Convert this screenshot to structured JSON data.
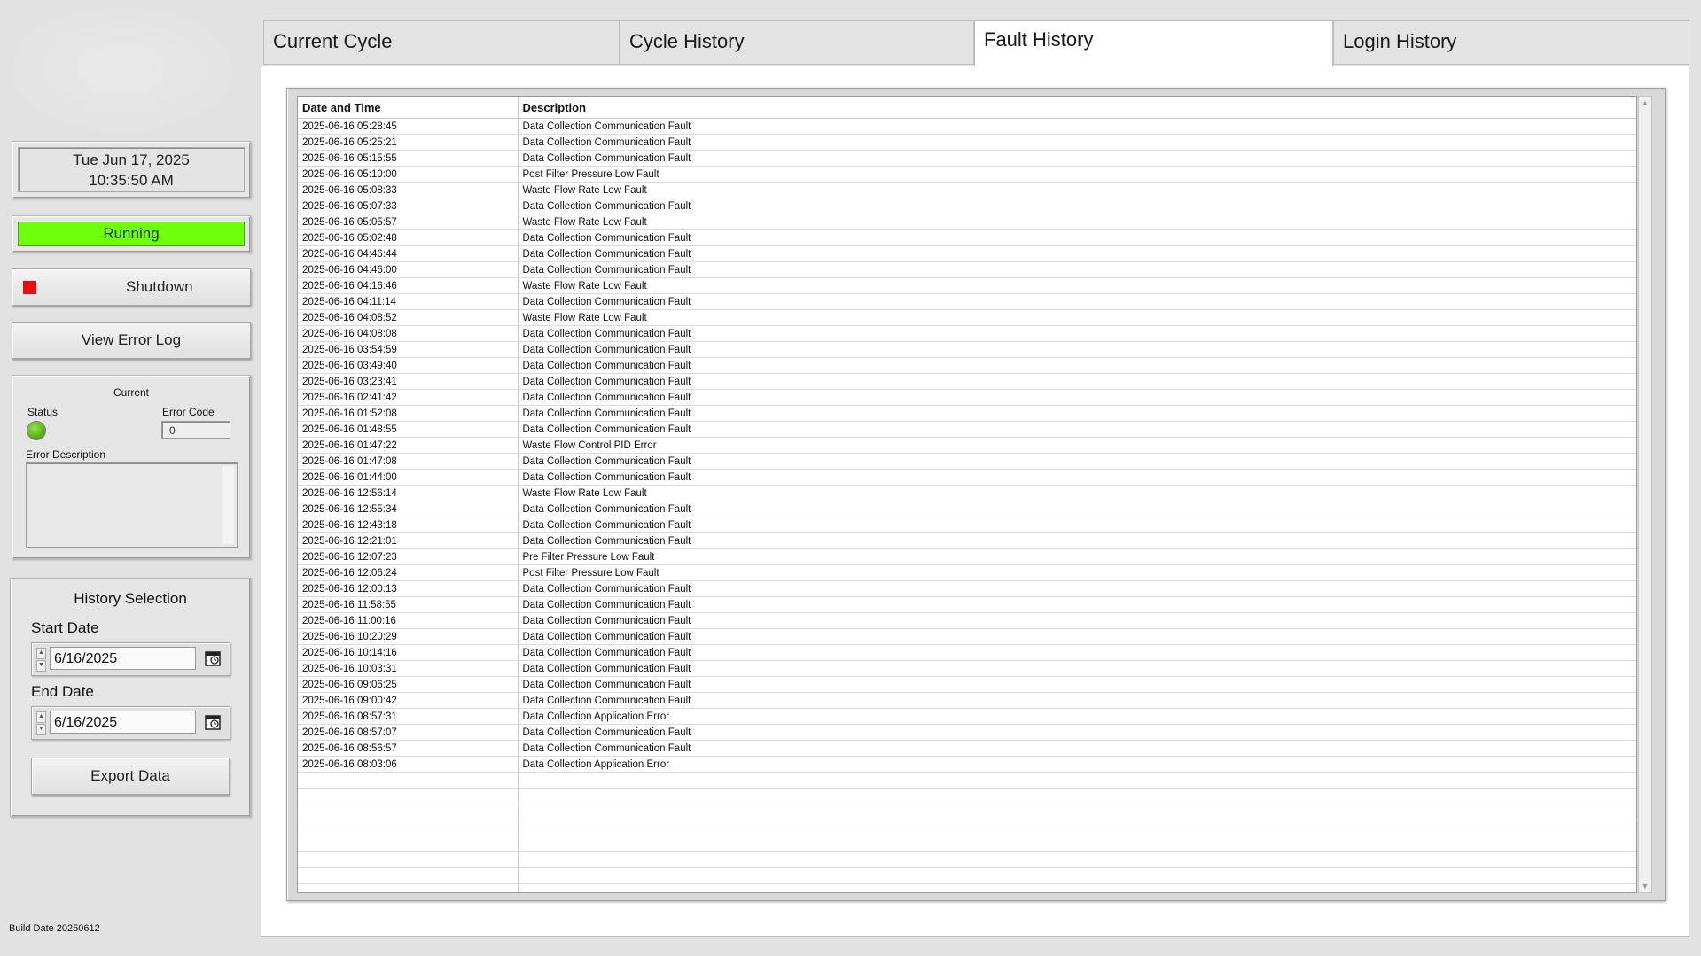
{
  "left_panel": {
    "date": "Tue Jun 17, 2025",
    "time": "10:35:50 AM",
    "status_text": "Running",
    "shutdown_label": "Shutdown",
    "error_log_label": "View Error Log",
    "current": {
      "title": "Current",
      "status_label": "Status",
      "error_code_label": "Error Code",
      "error_code_value": "0",
      "error_description_label": "Error Description",
      "error_description_value": ""
    },
    "history": {
      "title": "History Selection",
      "start_label": "Start Date",
      "start_value": "6/16/2025",
      "end_label": "End Date",
      "end_value": "6/16/2025",
      "export_label": "Export Data"
    },
    "build_date": "Build Date 20250612"
  },
  "tabs": [
    "Current Cycle",
    "Cycle History",
    "Fault History",
    "Login History"
  ],
  "active_tab": "Fault History",
  "fault_table": {
    "headers": [
      "Date and Time",
      "Description"
    ],
    "rows": [
      [
        "2025-06-16 05:28:45",
        "Data Collection Communication Fault"
      ],
      [
        "2025-06-16 05:25:21",
        "Data Collection Communication Fault"
      ],
      [
        "2025-06-16 05:15:55",
        "Data Collection Communication Fault"
      ],
      [
        "2025-06-16 05:10:00",
        "Post Filter Pressure Low Fault"
      ],
      [
        "2025-06-16 05:08:33",
        "Waste Flow Rate Low Fault"
      ],
      [
        "2025-06-16 05:07:33",
        "Data Collection Communication Fault"
      ],
      [
        "2025-06-16 05:05:57",
        "Waste Flow Rate Low Fault"
      ],
      [
        "2025-06-16 05:02:48",
        "Data Collection Communication Fault"
      ],
      [
        "2025-06-16 04:46:44",
        "Data Collection Communication Fault"
      ],
      [
        "2025-06-16 04:46:00",
        "Data Collection Communication Fault"
      ],
      [
        "2025-06-16 04:16:46",
        "Waste Flow Rate Low Fault"
      ],
      [
        "2025-06-16 04:11:14",
        "Data Collection Communication Fault"
      ],
      [
        "2025-06-16 04:08:52",
        "Waste Flow Rate Low Fault"
      ],
      [
        "2025-06-16 04:08:08",
        "Data Collection Communication Fault"
      ],
      [
        "2025-06-16 03:54:59",
        "Data Collection Communication Fault"
      ],
      [
        "2025-06-16 03:49:40",
        "Data Collection Communication Fault"
      ],
      [
        "2025-06-16 03:23:41",
        "Data Collection Communication Fault"
      ],
      [
        "2025-06-16 02:41:42",
        "Data Collection Communication Fault"
      ],
      [
        "2025-06-16 01:52:08",
        "Data Collection Communication Fault"
      ],
      [
        "2025-06-16 01:48:55",
        "Data Collection Communication Fault"
      ],
      [
        "2025-06-16 01:47:22",
        "Waste Flow Control PID Error"
      ],
      [
        "2025-06-16 01:47:08",
        "Data Collection Communication Fault"
      ],
      [
        "2025-06-16 01:44:00",
        "Data Collection Communication Fault"
      ],
      [
        "2025-06-16 12:56:14",
        "Waste Flow Rate Low Fault"
      ],
      [
        "2025-06-16 12:55:34",
        "Data Collection Communication Fault"
      ],
      [
        "2025-06-16 12:43:18",
        "Data Collection Communication Fault"
      ],
      [
        "2025-06-16 12:21:01",
        "Data Collection Communication Fault"
      ],
      [
        "2025-06-16 12:07:23",
        "Pre Filter Pressure Low Fault"
      ],
      [
        "2025-06-16 12:06:24",
        "Post Filter Pressure Low Fault"
      ],
      [
        "2025-06-16 12:00:13",
        "Data Collection Communication Fault"
      ],
      [
        "2025-06-16 11:58:55",
        "Data Collection Communication Fault"
      ],
      [
        "2025-06-16 11:00:16",
        "Data Collection Communication Fault"
      ],
      [
        "2025-06-16 10:20:29",
        "Data Collection Communication Fault"
      ],
      [
        "2025-06-16 10:14:16",
        "Data Collection Communication Fault"
      ],
      [
        "2025-06-16 10:03:31",
        "Data Collection Communication Fault"
      ],
      [
        "2025-06-16 09:06:25",
        "Data Collection Communication Fault"
      ],
      [
        "2025-06-16 09:00:42",
        "Data Collection Communication Fault"
      ],
      [
        "2025-06-16 08:57:31",
        "Data Collection Application Error"
      ],
      [
        "2025-06-16 08:57:07",
        "Data Collection Communication Fault"
      ],
      [
        "2025-06-16 08:56:57",
        "Data Collection Communication Fault"
      ],
      [
        "2025-06-16 08:03:06",
        "Data Collection Application Error"
      ]
    ]
  },
  "colors": {
    "running_green": "#6fff0a",
    "shutdown_red": "#e8100e",
    "status_led_green": "#5cb61a"
  }
}
